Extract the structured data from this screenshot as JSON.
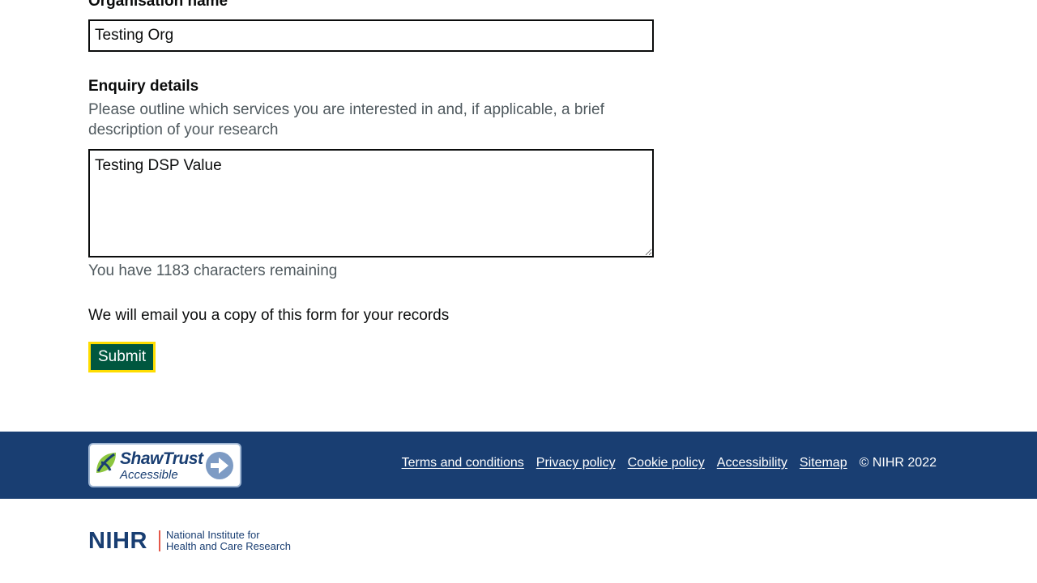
{
  "form": {
    "org_label": "Organisation name",
    "org_value": "Testing Org",
    "enquiry_label": "Enquiry details",
    "enquiry_hint": "Please outline which services you are interested in and, if applicable, a brief description of your research",
    "enquiry_value": "Testing DSP Value",
    "char_count_text": "You have 1183 characters remaining",
    "email_note": "We will email you a copy of this form for your records",
    "submit_label": "Submit"
  },
  "footer": {
    "badge": {
      "title": "ShawTrust",
      "subtitle": "Accessible",
      "icon": "arrow-right-circle-icon"
    },
    "links": [
      {
        "label": "Terms and conditions"
      },
      {
        "label": "Privacy policy"
      },
      {
        "label": "Cookie policy"
      },
      {
        "label": "Accessibility"
      },
      {
        "label": "Sitemap"
      }
    ],
    "copyright": "© NIHR 2022"
  },
  "logo": {
    "acronym": "NIHR",
    "line1": "National Institute for",
    "line2": "Health and Care Research"
  },
  "colors": {
    "footer_bg": "#193e72",
    "button_bg": "#00573f",
    "focus_outline": "#ffdd00",
    "hint_text": "#505a5f",
    "logo_accent": "#e5584a"
  }
}
